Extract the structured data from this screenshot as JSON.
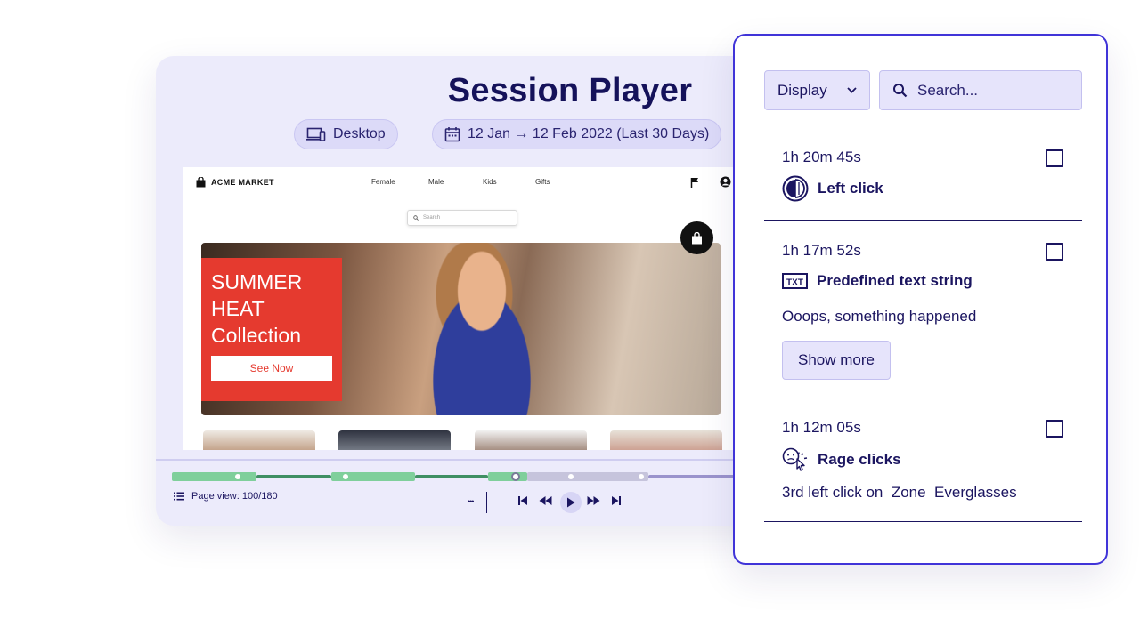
{
  "player": {
    "title": "Session Player",
    "device_label": "Desktop",
    "date_range": "12 Jan → 12 Feb 2022 (Last 30 Days)",
    "page_view": "Page view: 100/180"
  },
  "site": {
    "logo": "ACME MARKET",
    "nav": [
      "Female",
      "Male",
      "Kids",
      "Gifts"
    ],
    "search_placeholder": "Search",
    "promo_text": "SUMMER\nHEAT\nCollection",
    "promo_button": "See Now"
  },
  "timeline": {
    "more_label": "•••",
    "colors": {
      "green": "#7fcf9b",
      "dark_green": "#3f8f63",
      "grey": "#c6c4dc",
      "purple": "#9a93cc"
    }
  },
  "panel": {
    "display_label": "Display",
    "search_placeholder": "Search...",
    "events": [
      {
        "time": "1h 20m 45s",
        "type": "Left click",
        "icon": "left-click-icon"
      },
      {
        "time": "1h 17m 52s",
        "type": "Predefined text string",
        "icon": "txt-icon",
        "description": "Ooops, something happened",
        "button": "Show more"
      },
      {
        "time": "1h 12m 05s",
        "type": "Rage clicks",
        "icon": "rage-click-icon",
        "description": "3rd left click on  Zone  Everglasses"
      }
    ],
    "accent": "#4034d8"
  }
}
